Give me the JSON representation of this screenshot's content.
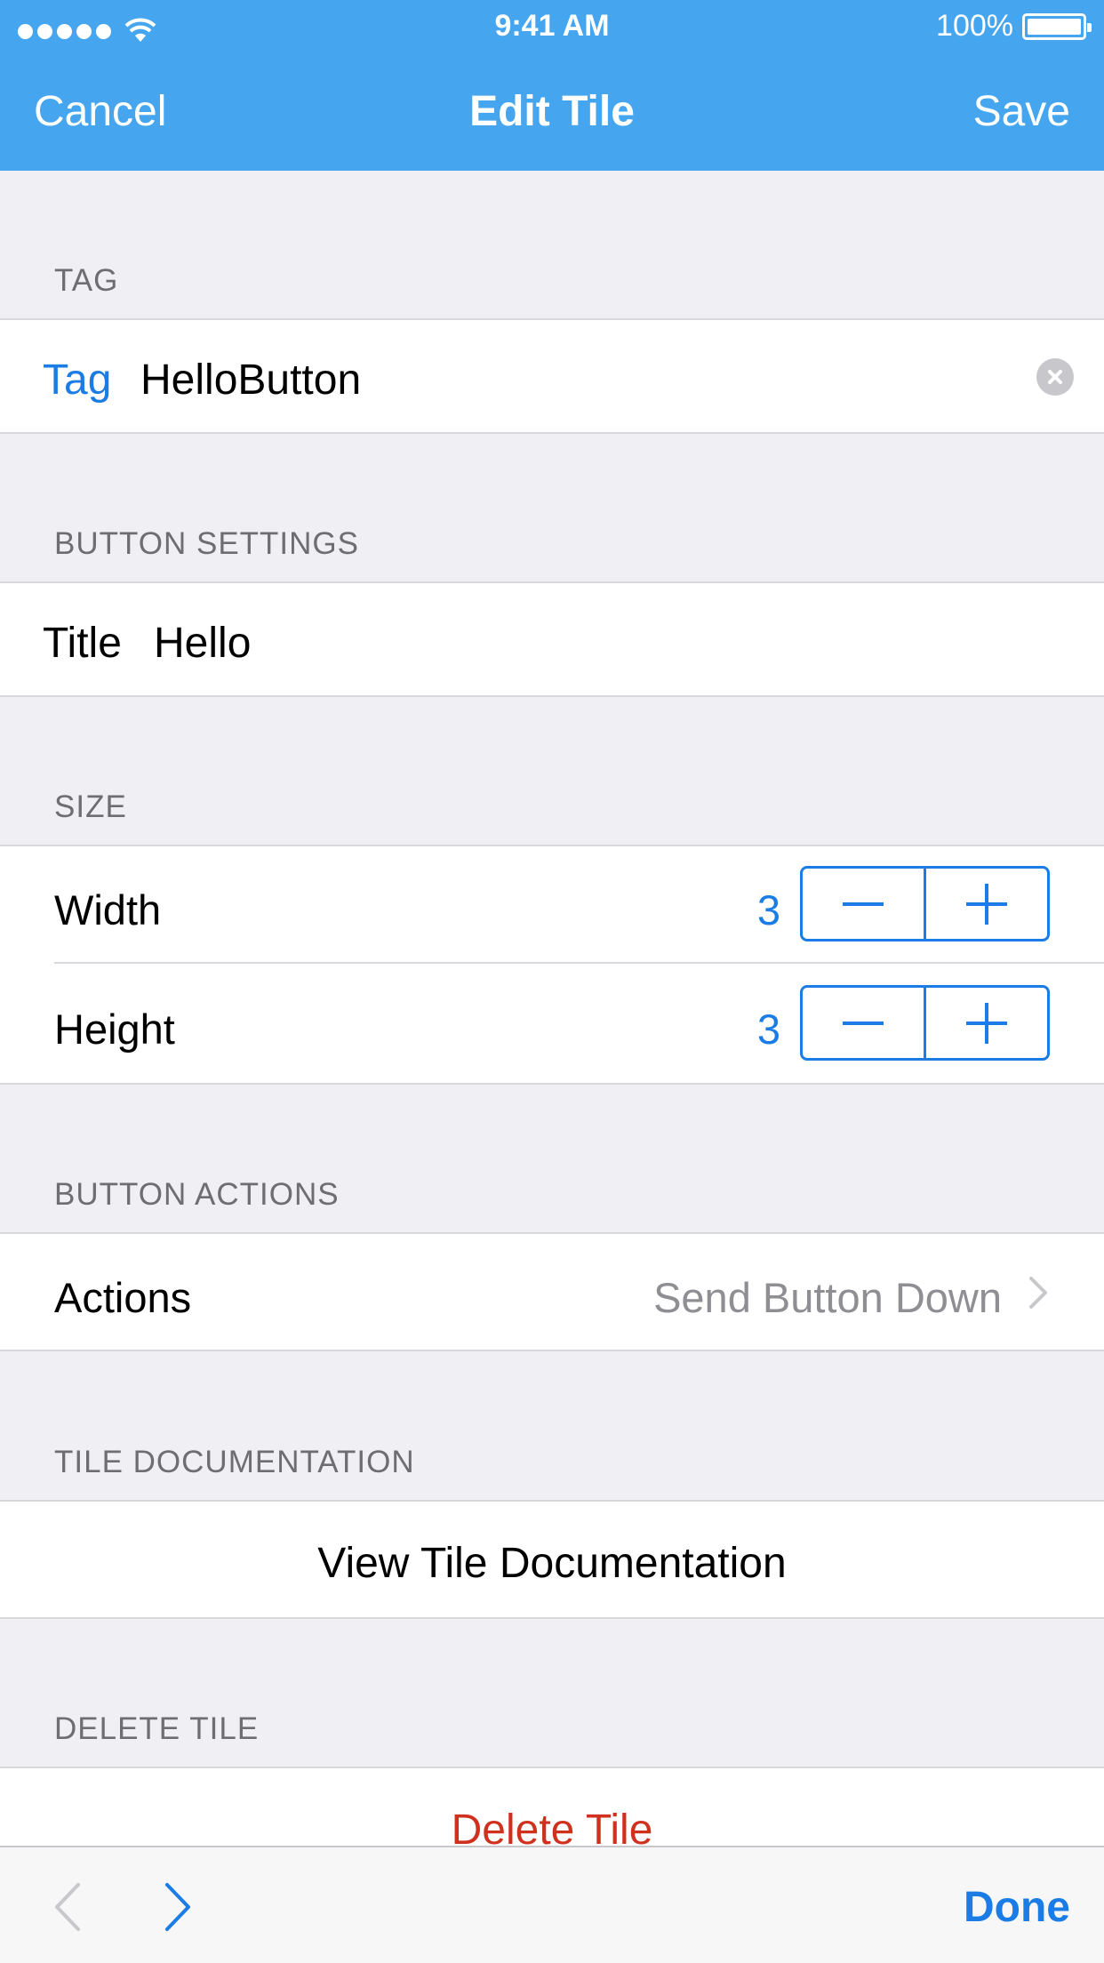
{
  "status_bar": {
    "time": "9:41 AM",
    "battery": "100%"
  },
  "nav": {
    "cancel": "Cancel",
    "title": "Edit Tile",
    "save": "Save"
  },
  "sections": {
    "tag": {
      "header": "TAG",
      "label": "Tag",
      "value": "HelloButton"
    },
    "button_settings": {
      "header": "BUTTON SETTINGS",
      "label": "Title",
      "value": "Hello"
    },
    "size": {
      "header": "SIZE",
      "width": {
        "label": "Width",
        "value": "3"
      },
      "height": {
        "label": "Height",
        "value": "3"
      }
    },
    "button_actions": {
      "header": "BUTTON ACTIONS",
      "label": "Actions",
      "value": "Send Button Down"
    },
    "tile_documentation": {
      "header": "TILE DOCUMENTATION",
      "label": "View Tile Documentation"
    },
    "delete_tile": {
      "header": "DELETE TILE",
      "label": "Delete Tile"
    }
  },
  "toolbar": {
    "done": "Done"
  },
  "colors": {
    "nav_blue": "#45a5ee",
    "tint": "#1a7ce4",
    "destructive": "#d0311f",
    "background": "#efeff4"
  },
  "icons": [
    "wifi-icon",
    "battery-icon",
    "clear-icon",
    "minus-icon",
    "plus-icon",
    "chevron-right-icon",
    "prev-arrow-icon",
    "next-arrow-icon"
  ]
}
